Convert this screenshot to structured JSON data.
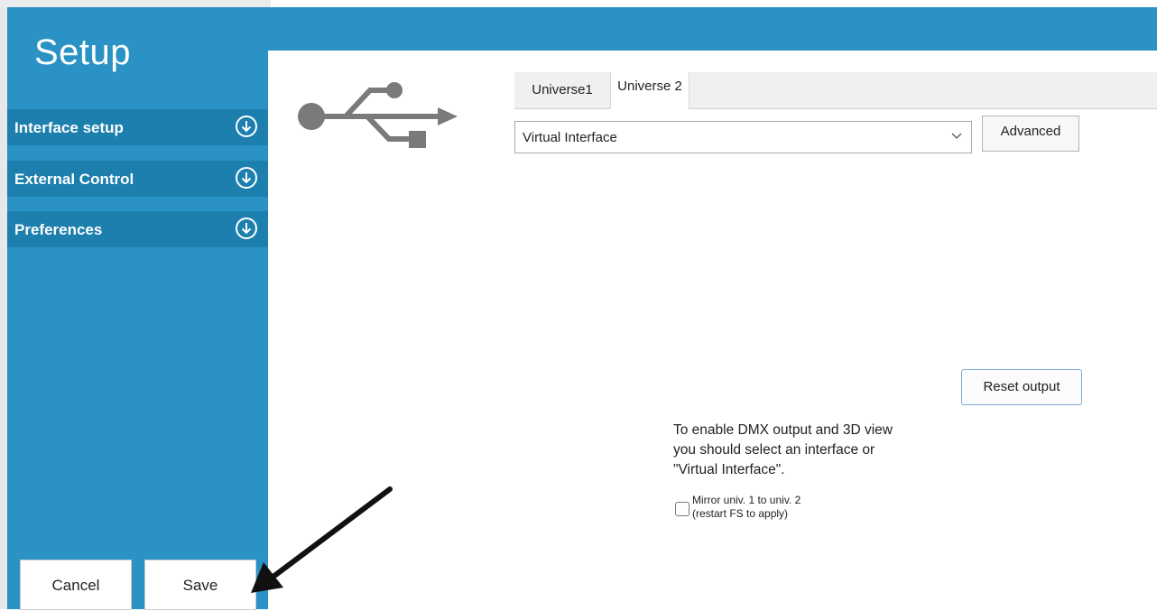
{
  "sidebar": {
    "title": "Setup",
    "items": [
      {
        "label": "Interface setup",
        "icon": "arrow-down-circle-icon"
      },
      {
        "label": "External Control",
        "icon": "arrow-down-circle-icon"
      },
      {
        "label": "Preferences",
        "icon": "arrow-down-circle-icon"
      }
    ],
    "cancel_label": "Cancel",
    "save_label": "Save"
  },
  "main": {
    "icon": "usb-icon",
    "tabs": [
      {
        "label": "Universe1",
        "active": false
      },
      {
        "label": "Universe 2",
        "active": true
      }
    ],
    "interface_select": {
      "value": "Virtual Interface"
    },
    "advanced_label": "Advanced",
    "reset_output_label": "Reset output",
    "info_lines": [
      "To enable DMX output and 3D view",
      "you should select an interface or",
      "\"Virtual Interface\"."
    ],
    "mirror_checkbox": {
      "checked": false,
      "label_line1": "Mirror univ. 1 to univ. 2",
      "label_line2": "(restart FS to apply)"
    }
  },
  "colors": {
    "accent_blue": "#2a92c4",
    "menu_blue": "#1c7fae"
  }
}
